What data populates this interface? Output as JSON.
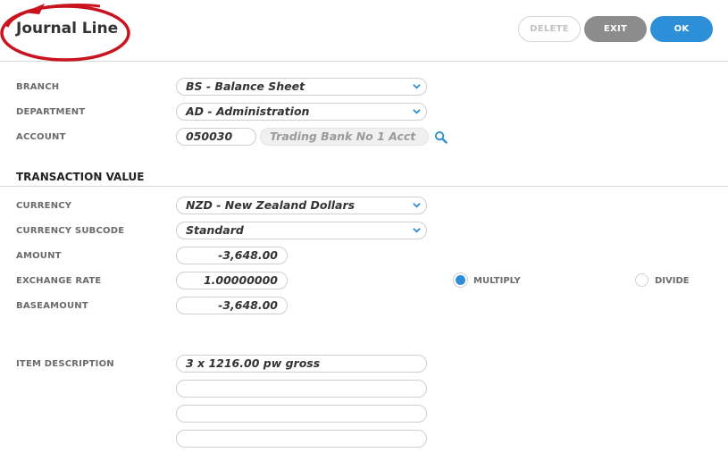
{
  "header": {
    "title": "Journal Line",
    "delete_label": "DELETE",
    "exit_label": "EXIT",
    "ok_label": "OK"
  },
  "form": {
    "branch": {
      "label": "BRANCH",
      "value": "BS - Balance Sheet"
    },
    "department": {
      "label": "DEPARTMENT",
      "value": "AD - Administration"
    },
    "account": {
      "label": "ACCOUNT",
      "code": "050030",
      "name": "Trading Bank No 1 Acct"
    }
  },
  "transaction": {
    "section_title": "TRANSACTION VALUE",
    "currency": {
      "label": "CURRENCY",
      "value": "NZD - New Zealand Dollars"
    },
    "currency_subcode": {
      "label": "CURRENCY SUBCODE",
      "value": "Standard"
    },
    "amount": {
      "label": "AMOUNT",
      "value": "-3,648.00"
    },
    "exchange_rate": {
      "label": "EXCHANGE RATE",
      "value": "1.00000000"
    },
    "baseamount": {
      "label": "BASEAMOUNT",
      "value": "-3,648.00"
    },
    "rate_mode": {
      "multiply_label": "MULTIPLY",
      "divide_label": "DIVIDE",
      "selected": "MULTIPLY"
    }
  },
  "description": {
    "label": "ITEM DESCRIPTION",
    "lines": [
      "3 x 1216.00 pw gross",
      "",
      "",
      ""
    ]
  },
  "colors": {
    "accent": "#2e8fd9",
    "annotation": "#c8141e"
  }
}
